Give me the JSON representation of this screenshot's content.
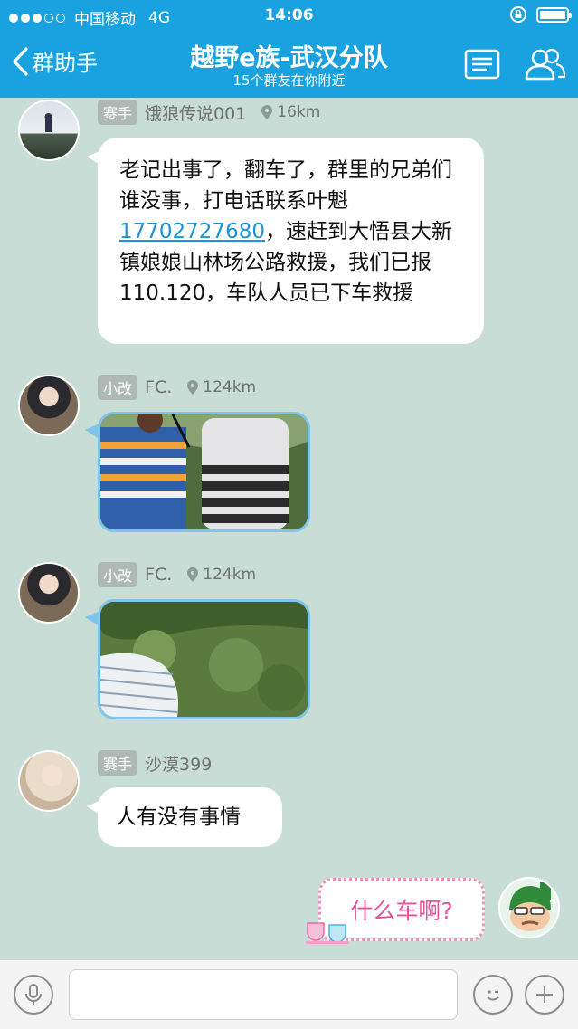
{
  "status_bar": {
    "carrier": "中国移动",
    "network": "4G",
    "time": "14:06"
  },
  "nav": {
    "back_label": "群助手",
    "title": "越野e族-武汉分队",
    "subtitle": "15个群友在你附近"
  },
  "messages": [
    {
      "badge": "赛手",
      "sender": "饿狼传说001",
      "distance": "16km",
      "text_before": "老记出事了，翻车了，群里的兄弟们谁没事，打电话联系叶魁",
      "phone": "17702727680",
      "text_after": "，速赶到大悟县大新镇娘娘山林场公路救援，我们已报110.120，车队人员已下车救援"
    },
    {
      "badge": "小改",
      "sender": "FC.",
      "distance": "124km",
      "type": "image"
    },
    {
      "badge": "小改",
      "sender": "FC.",
      "distance": "124km",
      "type": "image"
    },
    {
      "badge": "赛手",
      "sender": "沙漠399",
      "text": "人有没有事情"
    },
    {
      "type": "outgoing-sticker",
      "text": "什么车啊?"
    }
  ],
  "colors": {
    "nav_blue": "#1aa2e0",
    "chat_bg": "#c7ddd6",
    "link": "#1b95d9",
    "sticker_pink": "#e8529a"
  },
  "icons": [
    "chevron-left-icon",
    "menu-icon",
    "members-icon",
    "location-pin-icon",
    "microphone-icon",
    "emoji-icon",
    "plus-icon"
  ]
}
